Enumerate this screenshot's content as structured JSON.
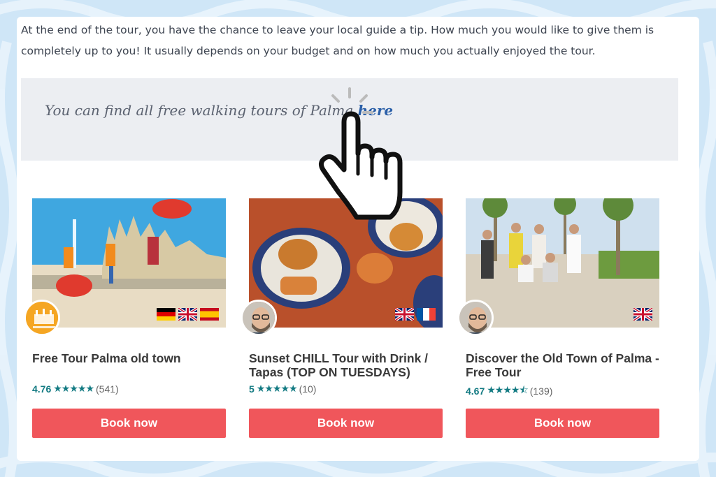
{
  "intro_text": "At the end of the tour, you have the chance to leave your local guide a tip. How much you would like to give them is completely up to you! It usually depends on your budget and on how much you actually enjoyed the tour.",
  "quote": {
    "text": "You can find all free walking tours of Palma ",
    "link_label": "here"
  },
  "tours": [
    {
      "title": "Free Tour Palma old town",
      "rating": "4.76",
      "stars": "★★★★★",
      "count": "(541)",
      "button": "Book now",
      "flags": [
        "de",
        "gb",
        "es"
      ],
      "guide": "logo"
    },
    {
      "title": "Sunset CHILL Tour with Drink / Tapas (TOP ON TUESDAYS)",
      "rating": "5",
      "stars": "★★★★★",
      "count": "(10)",
      "button": "Book now",
      "flags": [
        "gb",
        "fr"
      ],
      "guide": "avatar"
    },
    {
      "title": "Discover the Old Town of Palma - Free Tour",
      "rating": "4.67",
      "stars": "★★★★⯪",
      "count": "(139)",
      "button": "Book now",
      "flags": [
        "gb"
      ],
      "guide": "avatar"
    }
  ],
  "colors": {
    "accent_button": "#f0565b",
    "rating_teal": "#127a82",
    "link_blue": "#2a5fa8",
    "background": "#cfe6f7"
  }
}
